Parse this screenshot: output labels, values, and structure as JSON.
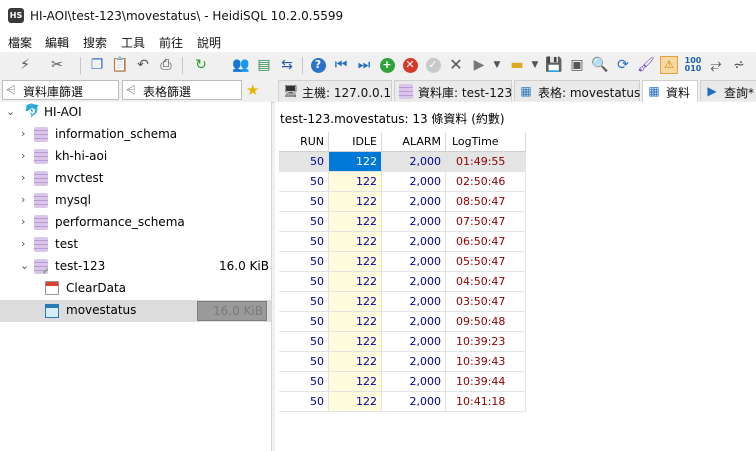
{
  "window": {
    "logo_text": "HS",
    "title": "HI-AOI\\test-123\\movestatus\\ - HeidiSQL 10.2.0.5599"
  },
  "menu": [
    "檔案",
    "編輯",
    "搜索",
    "工具",
    "前往",
    "說明"
  ],
  "colors": {
    "accent": "#0078d7",
    "number_text": "#00009c",
    "time_text": "#8b0000",
    "idle_column_bg": "#fffbdd"
  },
  "toolbar_icons": [
    "connect-icon",
    "disconnect-icon",
    "copy-icon",
    "paste-icon",
    "undo-icon",
    "print-icon",
    "refresh-icon",
    "user-manager-icon",
    "export-icon",
    "transfer-icon",
    "help-icon",
    "first-record-icon",
    "last-record-icon",
    "insert-record-icon",
    "delete-record-icon",
    "post-icon",
    "cancel-icon",
    "run-icon",
    "load-sql-icon",
    "save-sql-icon",
    "query-icon",
    "find-icon",
    "replace-icon",
    "format-icon",
    "warning-icon",
    "binary-icon",
    "wrap-icon",
    "filter-icon"
  ],
  "filters": {
    "database_filter": "資料庫篩選",
    "table_filter": "表格篩選"
  },
  "tabs": [
    {
      "icon": "host-icon",
      "label": "主機: 127.0.0.1"
    },
    {
      "icon": "database-icon",
      "label": "資料庫: test-123"
    },
    {
      "icon": "table-icon",
      "label": "表格: movestatus"
    },
    {
      "icon": "data-grid-icon",
      "label": "資料"
    },
    {
      "icon": "query-icon",
      "label": "查詢*"
    }
  ],
  "tree": {
    "root": "HI-AOI",
    "databases": [
      {
        "name": "information_schema"
      },
      {
        "name": "kh-hi-aoi"
      },
      {
        "name": "mvctest"
      },
      {
        "name": "mysql"
      },
      {
        "name": "performance_schema"
      },
      {
        "name": "test"
      },
      {
        "name": "test-123",
        "size": "16.0 KiB"
      }
    ],
    "children": [
      {
        "name": "ClearData",
        "icon": "calendar-event-icon"
      },
      {
        "name": "movestatus",
        "icon": "table-icon",
        "size": "16.0 KiB"
      }
    ]
  },
  "data_tab": {
    "info": "test-123.movestatus: 13 條資料 (約數)",
    "columns": [
      "RUN",
      "IDLE",
      "ALARM",
      "LogTime"
    ],
    "rows": [
      [
        "50",
        "122",
        "2,000",
        "01:49:55"
      ],
      [
        "50",
        "122",
        "2,000",
        "02:50:46"
      ],
      [
        "50",
        "122",
        "2,000",
        "08:50:47"
      ],
      [
        "50",
        "122",
        "2,000",
        "07:50:47"
      ],
      [
        "50",
        "122",
        "2,000",
        "06:50:47"
      ],
      [
        "50",
        "122",
        "2,000",
        "05:50:47"
      ],
      [
        "50",
        "122",
        "2,000",
        "04:50:47"
      ],
      [
        "50",
        "122",
        "2,000",
        "03:50:47"
      ],
      [
        "50",
        "122",
        "2,000",
        "09:50:48"
      ],
      [
        "50",
        "122",
        "2,000",
        "10:39:23"
      ],
      [
        "50",
        "122",
        "2,000",
        "10:39:43"
      ],
      [
        "50",
        "122",
        "2,000",
        "10:39:44"
      ],
      [
        "50",
        "122",
        "2,000",
        "10:41:18"
      ]
    ]
  }
}
